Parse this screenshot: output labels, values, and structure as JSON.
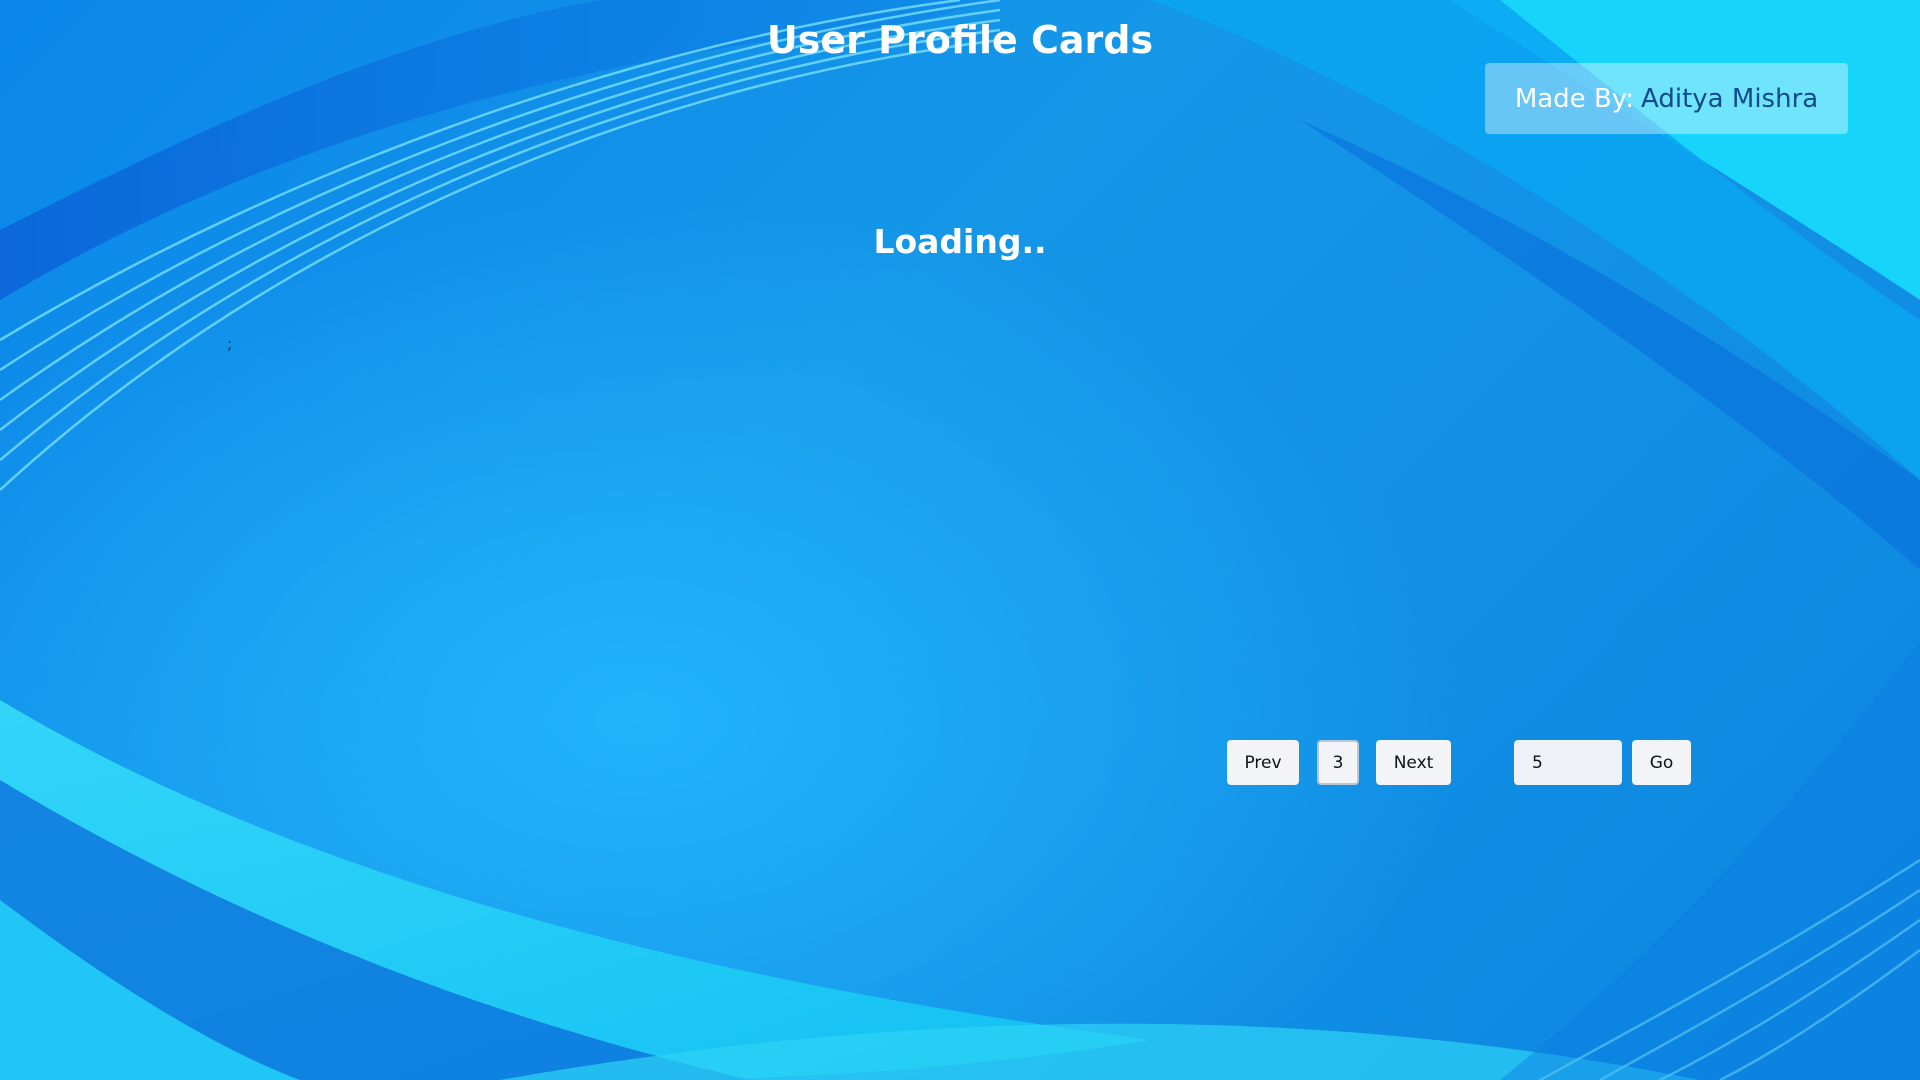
{
  "header": {
    "title": "User Profile Cards"
  },
  "credit": {
    "label": "Made By:",
    "name": "Aditya Mishra"
  },
  "status": {
    "loading_text": "Loading..",
    "stray_text": ";"
  },
  "pagination": {
    "prev_label": "Prev",
    "current_page": "3",
    "next_label": "Next",
    "goto_value": "5",
    "go_label": "Go"
  },
  "colors": {
    "background_accent": "#1597e8",
    "credit_name": "#124a8a",
    "button_bg": "#f2f4f7"
  }
}
